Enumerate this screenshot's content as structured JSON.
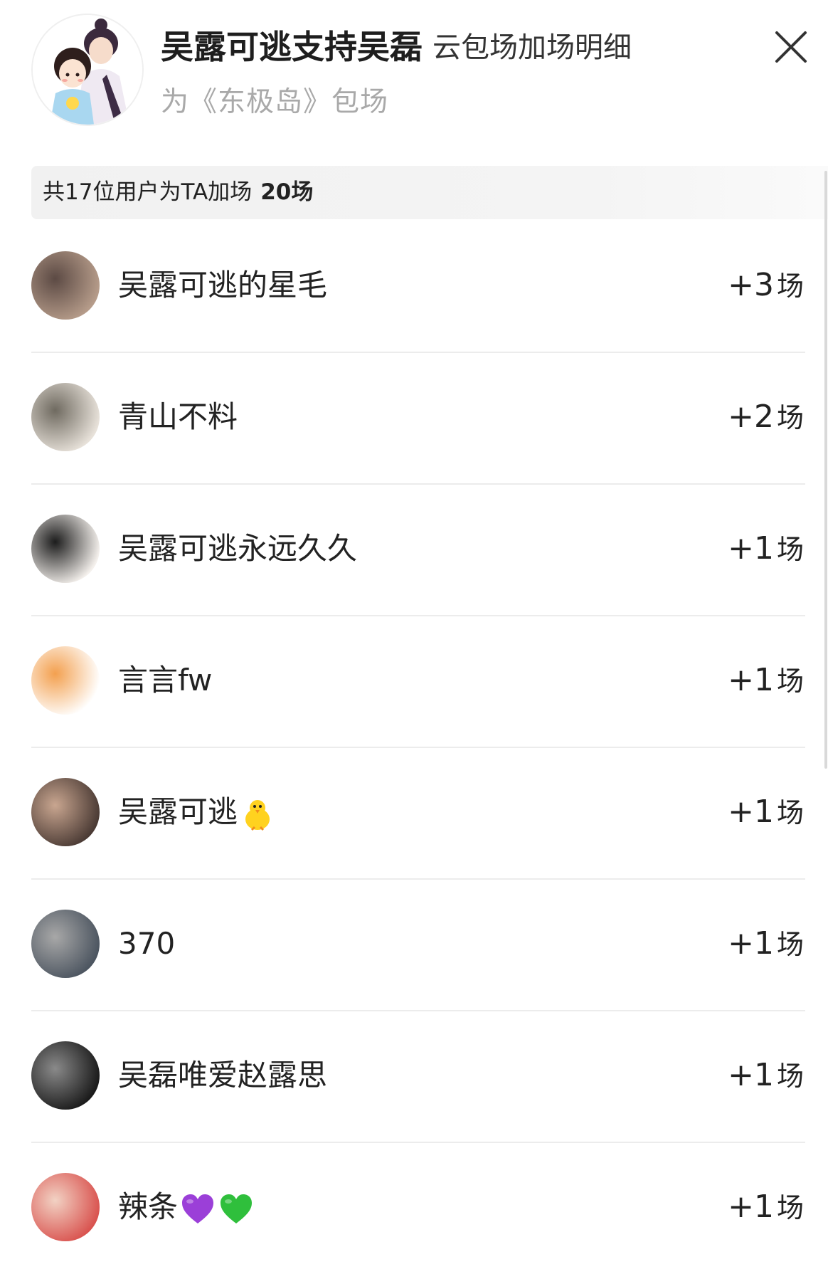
{
  "header": {
    "title": "吴露可逃支持吴磊",
    "title_suffix": "云包场加场明细",
    "subtitle": "为《东极岛》包场",
    "close_icon": "close-icon"
  },
  "summary": {
    "text": "共17位用户为TA加场",
    "count": "20场"
  },
  "list": [
    {
      "name": "吴露可逃的星毛",
      "emojis": [],
      "count_prefix": "+3",
      "count_unit": "场",
      "avatar_colors": [
        "#b69c8a",
        "#5c4a44"
      ]
    },
    {
      "name": "青山不料",
      "emojis": [],
      "count_prefix": "+2",
      "count_unit": "场",
      "avatar_colors": [
        "#e8e2da",
        "#6f6a60"
      ]
    },
    {
      "name": "吴露可逃永远久久",
      "emojis": [],
      "count_prefix": "+1",
      "count_unit": "场",
      "avatar_colors": [
        "#f4f0ec",
        "#1c1c1c"
      ]
    },
    {
      "name": "言言fw",
      "emojis": [],
      "count_prefix": "+1",
      "count_unit": "场",
      "avatar_colors": [
        "#ffffff",
        "#f3a04f"
      ]
    },
    {
      "name": "吴露可逃",
      "emojis": [
        "chick-emoji"
      ],
      "count_prefix": "+1",
      "count_unit": "场",
      "avatar_colors": [
        "#4a3a34",
        "#c9a690"
      ]
    },
    {
      "name": "370",
      "emojis": [],
      "count_prefix": "+1",
      "count_unit": "场",
      "avatar_colors": [
        "#4c5560",
        "#a8a8a8"
      ]
    },
    {
      "name": "吴磊唯爱赵露思",
      "emojis": [],
      "count_prefix": "+1",
      "count_unit": "场",
      "avatar_colors": [
        "#1a1a1a",
        "#8a8a8a"
      ]
    },
    {
      "name": "辣条",
      "emojis": [
        "purple-heart-emoji",
        "green-heart-emoji"
      ],
      "count_prefix": "+1",
      "count_unit": "场",
      "avatar_colors": [
        "#d9534f",
        "#f2d2c4"
      ]
    }
  ],
  "colors": {
    "purple_heart": "#9b3fd8",
    "green_heart": "#2fbf3c",
    "chick": "#ffd21f"
  }
}
